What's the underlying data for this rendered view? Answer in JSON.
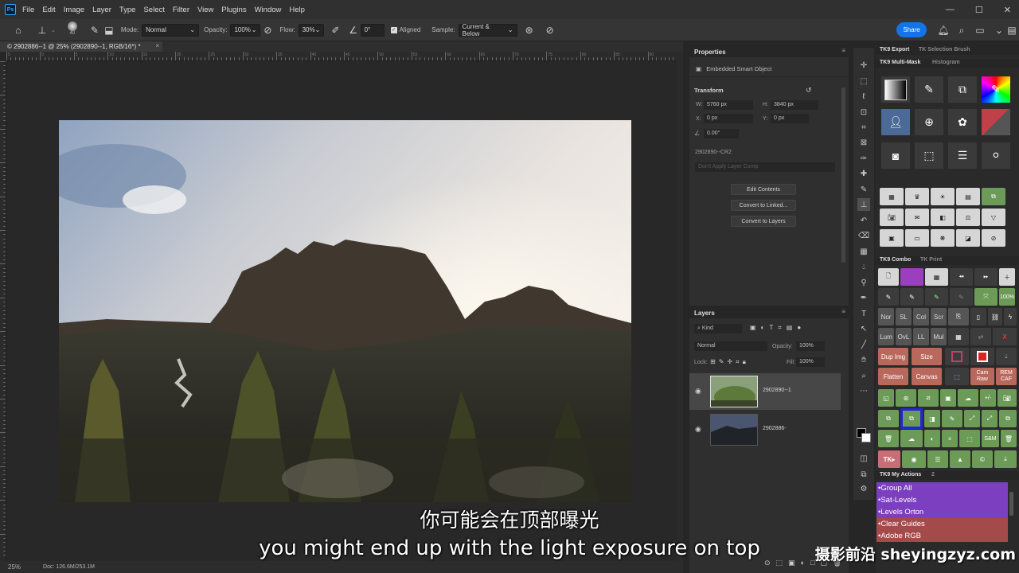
{
  "menubar": {
    "logo": "Ps",
    "items": [
      "File",
      "Edit",
      "Image",
      "Layer",
      "Type",
      "Select",
      "Filter",
      "View",
      "Plugins",
      "Window",
      "Help"
    ]
  },
  "options": {
    "brush_size": "40",
    "mode_label": "Mode:",
    "mode_value": "Normal",
    "opacity_label": "Opacity:",
    "opacity_value": "100%",
    "flow_label": "Flow:",
    "flow_value": "30%",
    "angle_value": "0°",
    "aligned_label": "Aligned",
    "sample_label": "Sample:",
    "sample_value": "Current & Below",
    "share_label": "Share"
  },
  "document": {
    "tab_title": "© 2902886--1 @ 25% (2902890--1, RGB/16*) *",
    "zoom": "25%",
    "doc_info": "Doc: 126.6M/253.1M",
    "ruler_labels": [
      "5",
      "0",
      "5",
      "10",
      "15",
      "20",
      "25",
      "30",
      "35",
      "40",
      "45",
      "50",
      "55",
      "60",
      "65",
      "70",
      "75",
      "80",
      "85",
      "90"
    ]
  },
  "properties": {
    "title": "Properties",
    "type": "Embedded Smart Object",
    "transform_title": "Transform",
    "w_label": "W:",
    "w_value": "5760 px",
    "h_label": "H:",
    "h_value": "3840 px",
    "x_label": "X:",
    "x_value": "0 px",
    "y_label": "Y:",
    "y_value": "0 px",
    "angle": "0.00°",
    "filename": "2902890--CR2",
    "layer_comp": "Don't Apply Layer Comp",
    "btn_edit": "Edit Contents",
    "btn_linked": "Convert to Linked...",
    "btn_layers": "Convert to Layers"
  },
  "layers": {
    "title": "Layers",
    "filter_kind": "Kind",
    "blend_mode": "Normal",
    "opacity_label": "Opacity:",
    "opacity_value": "100%",
    "lock_label": "Lock:",
    "fill_label": "Fill:",
    "fill_value": "100%",
    "items": [
      {
        "name": "2902890--1"
      },
      {
        "name": "2902886-"
      }
    ]
  },
  "tk": {
    "tab_export": "TK9 Export",
    "tab_selection": "TK Selection Brush",
    "tab_multimask": "TK9 Multi-Mask",
    "tab_histogram": "Histogram",
    "tab_combo": "TK9 Combo",
    "tab_print": "TK Print",
    "row_labels_1": [
      "Nor",
      "SL",
      "Col",
      "Scr"
    ],
    "row_labels_2": [
      "Lum",
      "OvL",
      "LL",
      "Mul"
    ],
    "btn_dup": "Dup Img",
    "btn_size": "Size",
    "btn_flatten": "Flatten",
    "btn_canvas": "Canvas",
    "btn_camraw": "Cam Raw",
    "btn_remcaf": "REM CAF",
    "btn_100": "100%",
    "btn_plusminus": "+/-",
    "btn_pm": "±",
    "btn_sm": "S&M",
    "btn_tk": "TK",
    "btn_x": "X",
    "my_actions_title": "TK9 My Actions",
    "my_actions_count": "2",
    "actions": [
      "•Group All",
      "•Sat-Levels",
      "•Levels Orton",
      "•Clear Guides",
      "•Adobe RGB"
    ]
  },
  "subtitles": {
    "cn": "你可能会在顶部曝光",
    "en": "you might end up with the light exposure on top"
  },
  "watermark": "摄影前沿 sheyingzyz.com",
  "colors": {
    "accent": "#1473e6",
    "action_purple": "#7b3fbf",
    "action_red": "#a54a4a"
  }
}
